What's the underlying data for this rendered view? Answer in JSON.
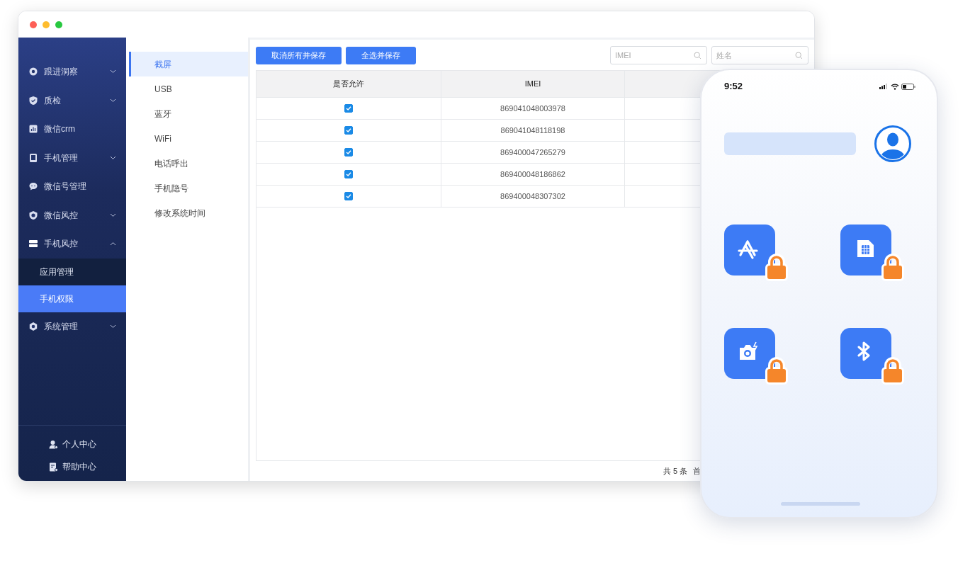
{
  "sidebar": {
    "items": [
      {
        "label": "跟进洞察",
        "expanded": false
      },
      {
        "label": "质检",
        "expanded": false
      },
      {
        "label": "微信crm"
      },
      {
        "label": "手机管理",
        "expanded": false
      },
      {
        "label": "微信号管理"
      },
      {
        "label": "微信风控",
        "expanded": false
      },
      {
        "label": "手机风控",
        "expanded": true,
        "children": [
          {
            "label": "应用管理",
            "selected": false
          },
          {
            "label": "手机权限",
            "selected": true
          }
        ]
      },
      {
        "label": "系统管理",
        "expanded": false
      }
    ],
    "footer": [
      "个人中心",
      "帮助中心"
    ]
  },
  "submenu": [
    {
      "label": "截屏",
      "selected": true
    },
    {
      "label": "USB",
      "selected": false
    },
    {
      "label": "蓝牙",
      "selected": false
    },
    {
      "label": "WiFi",
      "selected": false
    },
    {
      "label": "电话呼出",
      "selected": false
    },
    {
      "label": "手机隐号",
      "selected": false
    },
    {
      "label": "修改系统时间",
      "selected": false
    }
  ],
  "toolbar": {
    "buttons": [
      "取消所有并保存",
      "全选并保存"
    ],
    "search_fields": [
      {
        "placeholder": "IMEI"
      },
      {
        "placeholder": "姓名"
      }
    ]
  },
  "table": {
    "columns": [
      "是否允许",
      "IMEI"
    ],
    "rows": [
      {
        "allowed": true,
        "imei": "869041048003978"
      },
      {
        "allowed": true,
        "imei": "869041048118198"
      },
      {
        "allowed": true,
        "imei": "869400047265279"
      },
      {
        "allowed": true,
        "imei": "869400048186862"
      },
      {
        "allowed": true,
        "imei": "869400048307302"
      }
    ]
  },
  "pagination": {
    "total": "共 5 条",
    "first": "首"
  },
  "phone": {
    "time": "9:52",
    "apps": [
      {
        "kind": "app-store",
        "locked": true
      },
      {
        "kind": "sim-card",
        "locked": true
      },
      {
        "kind": "camera",
        "locked": true
      },
      {
        "kind": "bluetooth",
        "locked": true
      }
    ]
  }
}
